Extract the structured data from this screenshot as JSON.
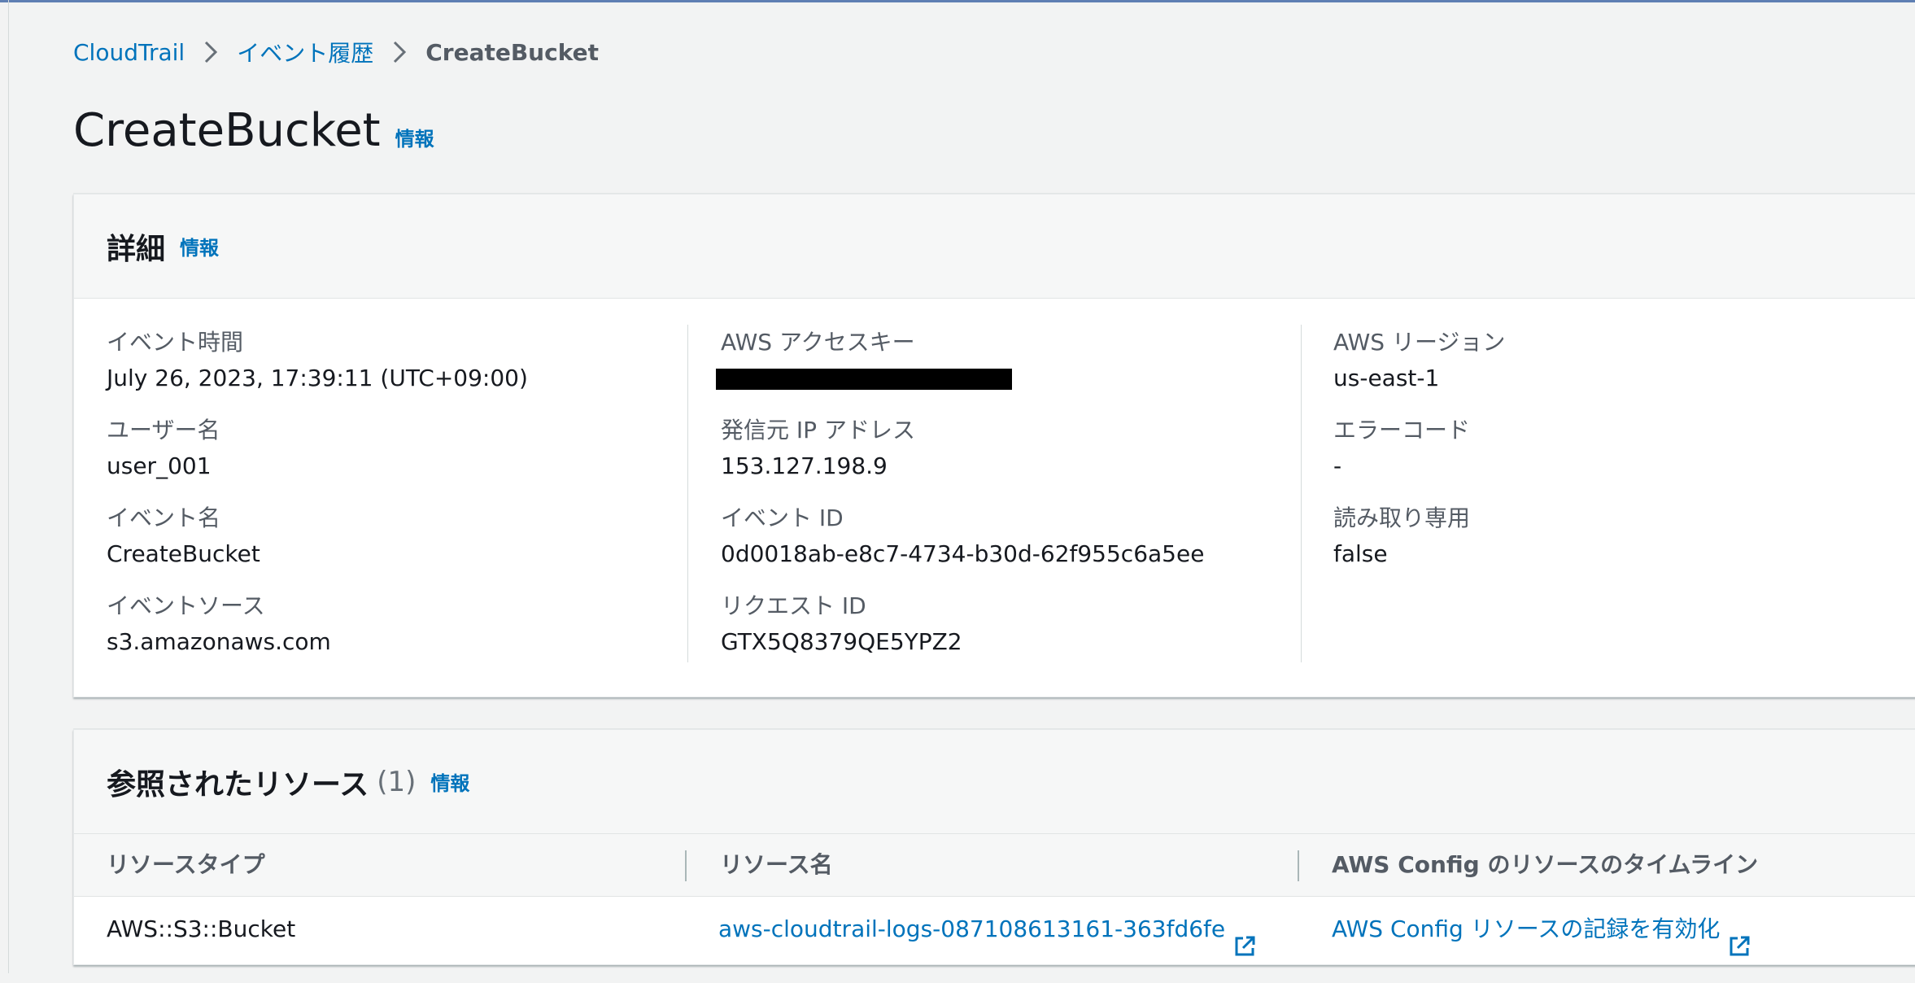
{
  "breadcrumb": {
    "items": [
      "CloudTrail",
      "イベント履歴"
    ],
    "current": "CreateBucket"
  },
  "page": {
    "title": "CreateBucket",
    "info_label": "情報"
  },
  "details": {
    "title": "詳細",
    "info_label": "情報",
    "columns": [
      [
        {
          "label": "イベント時間",
          "value": "July 26, 2023, 17:39:11 (UTC+09:00)"
        },
        {
          "label": "ユーザー名",
          "value": "user_001"
        },
        {
          "label": "イベント名",
          "value": "CreateBucket"
        },
        {
          "label": "イベントソース",
          "value": "s3.amazonaws.com"
        }
      ],
      [
        {
          "label": "AWS アクセスキー",
          "value": ""
        },
        {
          "label": "発信元 IP アドレス",
          "value": "153.127.198.9"
        },
        {
          "label": "イベント ID",
          "value": "0d0018ab-e8c7-4734-b30d-62f955c6a5ee"
        },
        {
          "label": "リクエスト ID",
          "value": "GTX5Q8379QE5YPZ2"
        }
      ],
      [
        {
          "label": "AWS リージョン",
          "value": "us-east-1"
        },
        {
          "label": "エラーコード",
          "value": "-"
        },
        {
          "label": "読み取り専用",
          "value": "false"
        }
      ]
    ]
  },
  "resources": {
    "title": "参照されたリソース",
    "count": "(1)",
    "info_label": "情報",
    "headers": [
      "リソースタイプ",
      "リソース名",
      "AWS Config のリソースのタイムライン"
    ],
    "rows": [
      {
        "type": "AWS::S3::Bucket",
        "name": "aws-cloudtrail-logs-087108613161-363fd6fe",
        "config": "AWS Config リソースの記録を有効化"
      }
    ]
  },
  "colors": {
    "link": "#0073bb",
    "background": "#f2f3f3",
    "panel_header": "#f6f7f7",
    "label": "#545b64"
  }
}
